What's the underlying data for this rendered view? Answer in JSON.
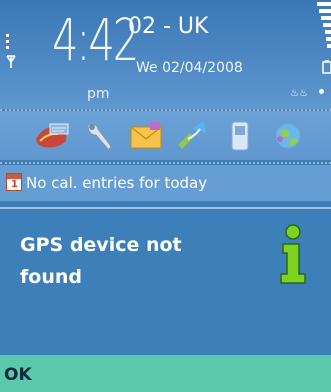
{
  "status": {
    "clock": "4:42",
    "ampm": "pm",
    "operator": "02 - UK",
    "date": "We 02/04/2008",
    "network_label": "♨♨"
  },
  "shortcuts": [
    {
      "name": "gps-app-icon"
    },
    {
      "name": "tools-icon"
    },
    {
      "name": "messaging-icon"
    },
    {
      "name": "connectivity-icon"
    },
    {
      "name": "phone-icon"
    },
    {
      "name": "web-globe-icon"
    }
  ],
  "calendar": {
    "icon_day": "1",
    "text": "No cal. entries for today"
  },
  "dialog": {
    "message": "GPS device not found"
  },
  "softkeys": {
    "left": "OK"
  }
}
